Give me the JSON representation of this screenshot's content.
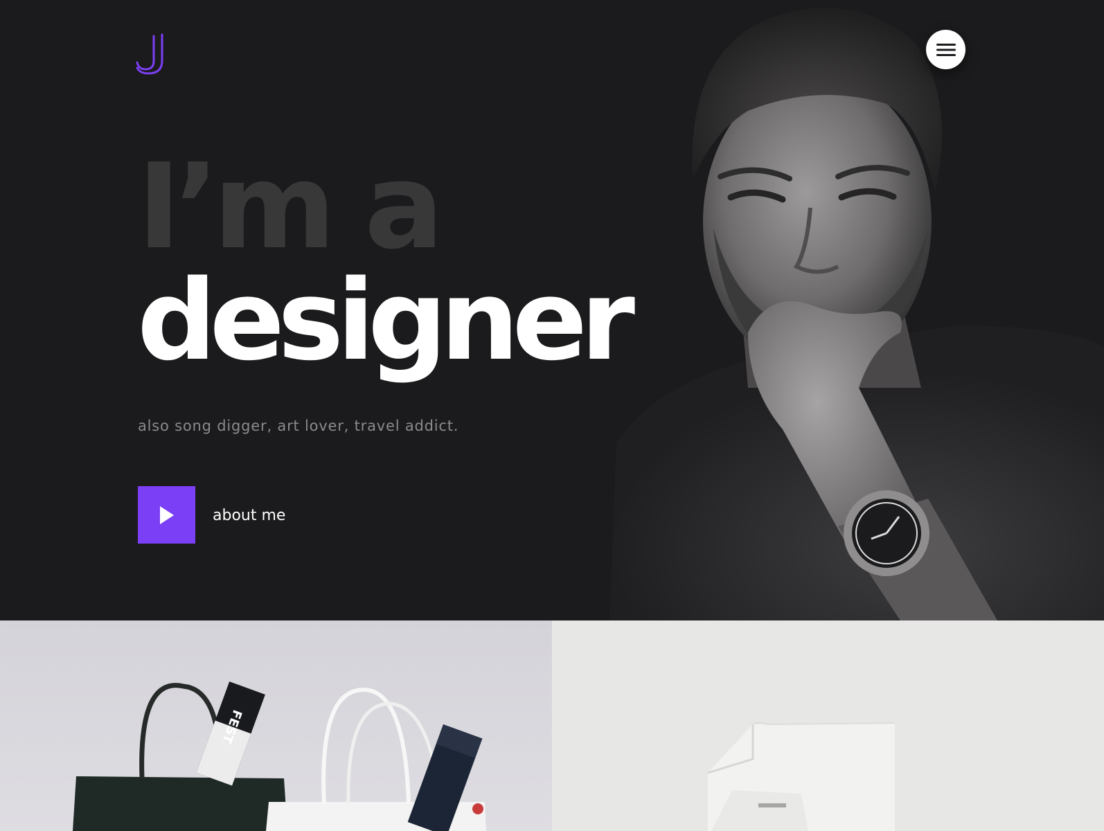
{
  "colors": {
    "accent": "#7b3ff5",
    "background": "#1b1a1c",
    "headline_dim": "#393839",
    "headline_bright": "#ffffff",
    "tagline": "#8b8a8d"
  },
  "header": {
    "logo_icon": "j-monogram-logo",
    "menu_icon": "hamburger-menu-icon"
  },
  "hero": {
    "headline_line1": "I’m a",
    "headline_line2": "designer",
    "tagline": "also song digger, art lover, travel addict.",
    "cta_icon": "play-icon",
    "cta_label": "about me",
    "photo_subject": "portrait-photo"
  },
  "portfolio": {
    "tiles": [
      {
        "image": "shopping-bags-photo"
      },
      {
        "image": "carton-package-photo"
      }
    ]
  }
}
